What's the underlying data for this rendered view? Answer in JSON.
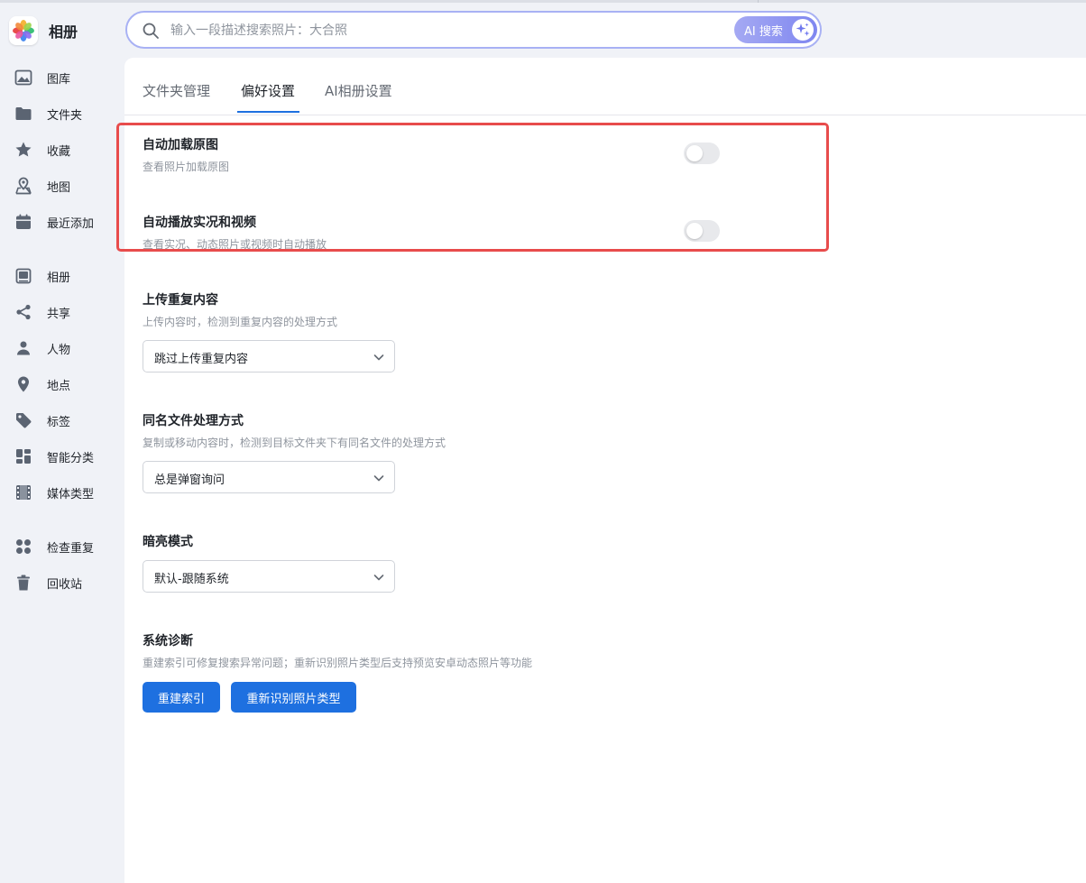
{
  "app": {
    "title": "相册"
  },
  "sidebar": {
    "items": [
      {
        "label": "图库",
        "icon": "image-icon"
      },
      {
        "label": "文件夹",
        "icon": "folder-icon"
      },
      {
        "label": "收藏",
        "icon": "star-icon"
      },
      {
        "label": "地图",
        "icon": "map-icon"
      },
      {
        "label": "最近添加",
        "icon": "calendar-icon"
      },
      {
        "label": "相册",
        "icon": "album-icon"
      },
      {
        "label": "共享",
        "icon": "share-icon"
      },
      {
        "label": "人物",
        "icon": "person-icon"
      },
      {
        "label": "地点",
        "icon": "location-pin-icon"
      },
      {
        "label": "标签",
        "icon": "tag-icon"
      },
      {
        "label": "智能分类",
        "icon": "grid-icon"
      },
      {
        "label": "媒体类型",
        "icon": "film-icon"
      },
      {
        "label": "检查重复",
        "icon": "duplicate-icon"
      },
      {
        "label": "回收站",
        "icon": "trash-icon"
      }
    ]
  },
  "search": {
    "placeholder": "输入一段描述搜索照片：大合照",
    "value": "",
    "ai_button_label": "AI 搜索"
  },
  "tabs": [
    {
      "label": "文件夹管理",
      "active": false
    },
    {
      "label": "偏好设置",
      "active": true
    },
    {
      "label": "AI相册设置",
      "active": false
    }
  ],
  "settings": {
    "auto_load_original": {
      "title": "自动加载原图",
      "desc": "查看照片加载原图",
      "enabled": false
    },
    "autoplay_live": {
      "title": "自动播放实况和视频",
      "desc": "查看实况、动态照片或视频时自动播放",
      "enabled": false
    },
    "upload_duplicate": {
      "title": "上传重复内容",
      "desc": "上传内容时，检测到重复内容的处理方式",
      "selected": "跳过上传重复内容"
    },
    "same_name": {
      "title": "同名文件处理方式",
      "desc": "复制或移动内容时，检测到目标文件夹下有同名文件的处理方式",
      "selected": "总是弹窗询问"
    },
    "dark_mode": {
      "title": "暗亮模式",
      "selected": "默认-跟随系统"
    },
    "diagnostics": {
      "title": "系统诊断",
      "desc": "重建索引可修复搜索异常问题；重新识别照片类型后支持预览安卓动态照片等功能",
      "rebuild_label": "重建索引",
      "reidentify_label": "重新识别照片类型"
    }
  },
  "colors": {
    "accent": "#1e70e0",
    "highlight": "#e84c4c",
    "ai_gradient_start": "#a5a9f3",
    "ai_gradient_end": "#7f87f0"
  }
}
